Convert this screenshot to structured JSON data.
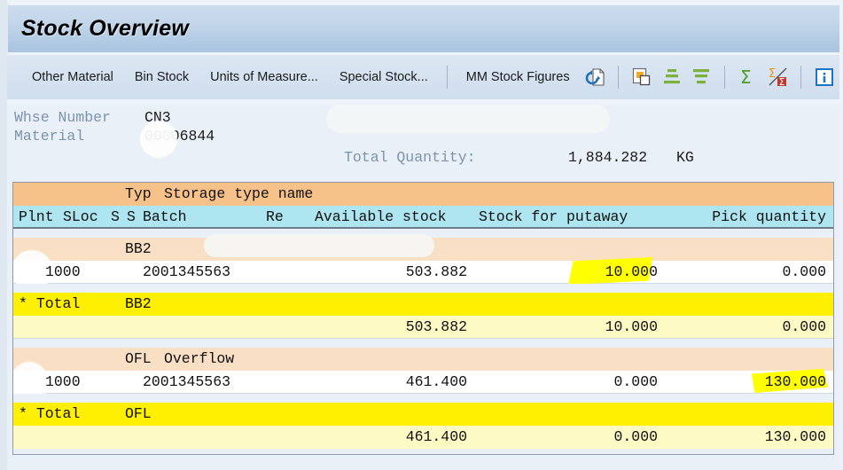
{
  "window": {
    "title": "Stock Overview"
  },
  "toolbar": {
    "buttons": [
      {
        "label": "Other Material",
        "name": "other-material-button"
      },
      {
        "label": "Bin Stock",
        "name": "bin-stock-button"
      },
      {
        "label": "Units of Measure...",
        "name": "units-of-measure-button"
      },
      {
        "label": "Special Stock...",
        "name": "special-stock-button"
      },
      {
        "label": "MM Stock Figures",
        "name": "mm-stock-figures-button"
      }
    ],
    "icons": [
      {
        "name": "refresh-document-icon",
        "title": "Refresh"
      },
      {
        "name": "copy-icon",
        "title": "Copy"
      },
      {
        "name": "expand-all-icon",
        "title": "Expand"
      },
      {
        "name": "collapse-all-icon",
        "title": "Collapse"
      },
      {
        "name": "sum-icon",
        "title": "Total"
      },
      {
        "name": "remove-sum-icon",
        "title": "Delete Total"
      },
      {
        "name": "info-icon",
        "title": "Information"
      }
    ]
  },
  "header": {
    "whse_label": "Whse Number",
    "whse_value": "CN3",
    "material_label": "Material",
    "material_value": "00006844",
    "material_description": "",
    "total_quantity_label": "Total Quantity:",
    "total_quantity_value": "1,884.282",
    "total_quantity_uom": "KG"
  },
  "table": {
    "group_header": {
      "typ": "Typ",
      "storage_type_name": "Storage type name"
    },
    "columns": {
      "plnt": "Plnt",
      "sloc": "SLoc",
      "s1": "S",
      "s2": "S",
      "batch": "Batch",
      "re": "Re",
      "available_stock": "Available stock",
      "stock_for_putaway": "Stock for putaway",
      "pick_quantity": "Pick quantity"
    },
    "sections": [
      {
        "typ": "BB2",
        "storage_type_name": "",
        "rows": [
          {
            "plnt": "1000",
            "sloc": "",
            "s1": "",
            "s2": "",
            "batch": "2001345563",
            "re": "",
            "available_stock": "503.882",
            "stock_for_putaway": "10.000",
            "pick_quantity": "0.000",
            "highlight": "stock_for_putaway"
          }
        ],
        "total": {
          "marker": "*",
          "label": "Total",
          "key": "BB2",
          "available_stock": "503.882",
          "stock_for_putaway": "10.000",
          "pick_quantity": "0.000"
        }
      },
      {
        "typ": "OFL",
        "storage_type_name": "Overflow",
        "rows": [
          {
            "plnt": "1000",
            "sloc": "",
            "s1": "",
            "s2": "",
            "batch": "2001345563",
            "re": "",
            "available_stock": "461.400",
            "stock_for_putaway": "0.000",
            "pick_quantity": "130.000",
            "highlight": "pick_quantity"
          }
        ],
        "total": {
          "marker": "*",
          "label": "Total",
          "key": "OFL",
          "available_stock": "461.400",
          "stock_for_putaway": "0.000",
          "pick_quantity": "130.000"
        }
      }
    ]
  },
  "colors": {
    "group_header_bg": "#f7c28a",
    "column_header_bg": "#ade5f0",
    "section_bg": "#f9e0c4",
    "total_header_bg": "#ffef00",
    "total_value_bg": "#fdfac4",
    "marker_highlight": "#ffff00",
    "title_bar": "#b4cce4"
  }
}
